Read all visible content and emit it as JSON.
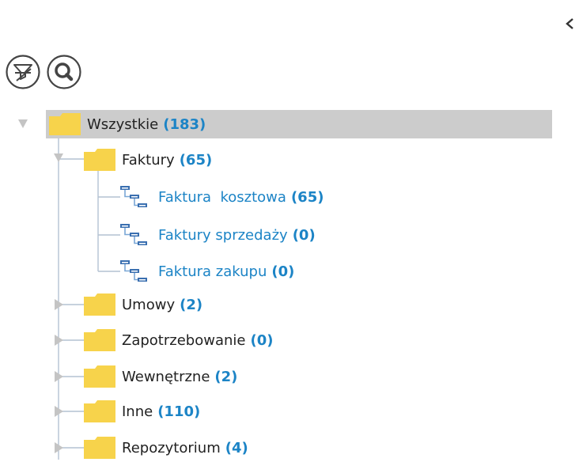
{
  "colors": {
    "accent": "#1c84c6",
    "selected_bg": "#cccccc",
    "folder": "#f7d34b",
    "tree_line": "#b4c2d2"
  },
  "icons": {
    "collapse": "chevron-left-icon",
    "filter": "filter-clear-icon",
    "search": "search-icon",
    "folder": "folder-icon",
    "report": "report-icon",
    "expanded": "triangle-down-icon",
    "collapsed": "triangle-right-icon"
  },
  "tree": {
    "root": {
      "name": "Wszystkie",
      "count": "(183)",
      "expanded": true,
      "selected": true
    },
    "faktury": {
      "name": "Faktury",
      "count": "(65)",
      "expanded": true,
      "children": [
        {
          "name": "Faktura  kosztowa",
          "count": "(65)"
        },
        {
          "name": "Faktury sprzedaży",
          "count": "(0)"
        },
        {
          "name": "Faktura zakupu",
          "count": "(0)"
        }
      ]
    },
    "folders": [
      {
        "name": "Umowy",
        "count": "(2)"
      },
      {
        "name": "Zapotrzebowanie",
        "count": "(0)"
      },
      {
        "name": "Wewnętrzne",
        "count": "(2)"
      },
      {
        "name": "Inne",
        "count": "(110)"
      },
      {
        "name": "Repozytorium",
        "count": "(4)"
      }
    ]
  }
}
